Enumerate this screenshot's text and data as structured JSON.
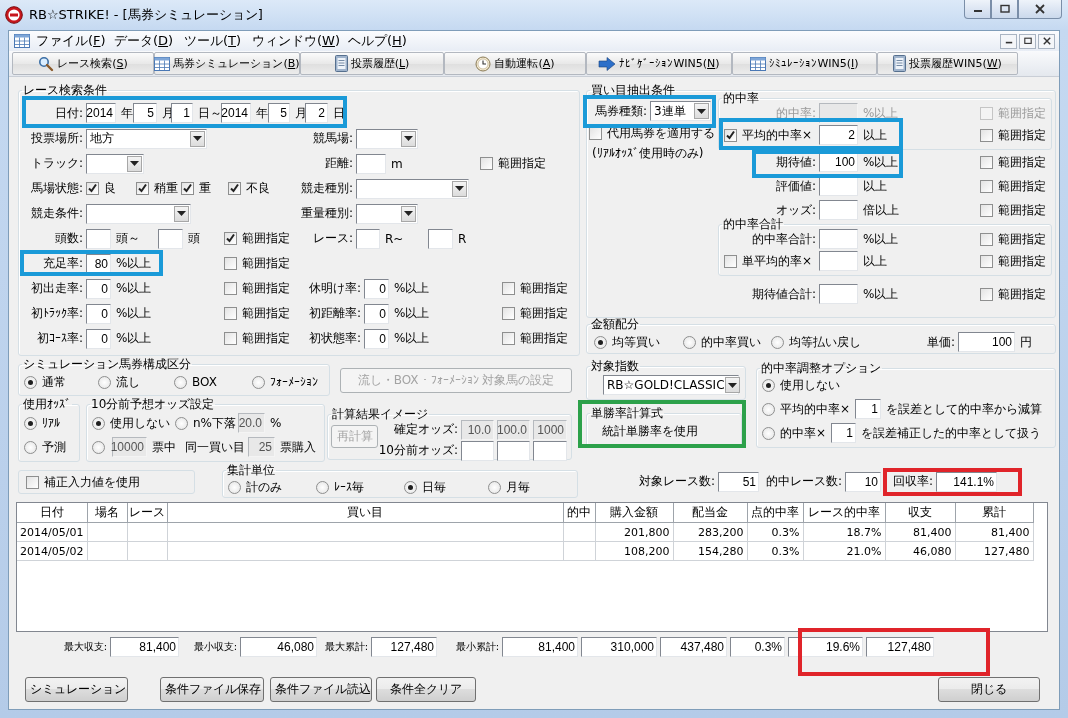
{
  "window": {
    "title": "RB☆STRIKE! - [馬券シミュレーション]"
  },
  "menu": [
    "ファイル(F)",
    "データ(D)",
    "ツール(T)",
    "ウィンドウ(W)",
    "ヘルプ(H)"
  ],
  "toolbar": [
    "レース検索(S)",
    "馬券シミュレーション(B)",
    "投票履歴(L)",
    "自動運転(A)",
    "ﾅﾋﾞｹﾞｰｼｮﾝWIN5(N)",
    "ｼﾐｭﾚｰｼｮﾝWIN5(I)",
    "投票履歴WIN5(W)"
  ],
  "search_conditions": {
    "title": "レース検索条件",
    "rows": [
      {
        "items": [
          {
            "kind": "label",
            "text": "日付:"
          },
          {
            "kind": "field",
            "value": "2014"
          },
          {
            "kind": "text",
            "text": "年"
          },
          {
            "kind": "field",
            "value": "5"
          },
          {
            "kind": "text",
            "text": "月"
          },
          {
            "kind": "field",
            "value": "1"
          },
          {
            "kind": "text",
            "text": "日～"
          },
          {
            "kind": "field",
            "value": "2014"
          },
          {
            "kind": "text",
            "text": "年"
          },
          {
            "kind": "field",
            "value": "5"
          },
          {
            "kind": "text",
            "text": "月"
          },
          {
            "kind": "field",
            "value": "2"
          },
          {
            "kind": "text",
            "text": "日"
          }
        ]
      },
      {
        "items": [
          {
            "kind": "label",
            "text": "投票場所:"
          },
          {
            "kind": "combo",
            "value": "地方"
          },
          {
            "kind": "label",
            "text": "競馬場:"
          },
          {
            "kind": "combo"
          }
        ]
      },
      {
        "items": [
          {
            "kind": "label",
            "text": "トラック:"
          },
          {
            "kind": "combo"
          },
          {
            "kind": "label",
            "text": "距離:"
          },
          {
            "kind": "field"
          },
          {
            "kind": "text",
            "text": "m"
          },
          {
            "kind": "check",
            "label": "範囲指定",
            "checked": false
          }
        ]
      },
      {
        "items": [
          {
            "kind": "label",
            "text": "馬場状態:"
          },
          {
            "kind": "check",
            "label": "良",
            "checked": true
          },
          {
            "kind": "check",
            "label": "稍重",
            "checked": true
          },
          {
            "kind": "check",
            "label": "重",
            "checked": true
          },
          {
            "kind": "check",
            "label": "不良",
            "checked": true
          },
          {
            "kind": "label",
            "text": "競走種別:"
          },
          {
            "kind": "combo"
          }
        ]
      },
      {
        "items": [
          {
            "kind": "label",
            "text": "競走条件:"
          },
          {
            "kind": "combo"
          },
          {
            "kind": "label",
            "text": "重量種別:"
          },
          {
            "kind": "combo"
          }
        ]
      },
      {
        "items": [
          {
            "kind": "label",
            "text": "頭数:"
          },
          {
            "kind": "field"
          },
          {
            "kind": "text",
            "text": "頭～"
          },
          {
            "kind": "field"
          },
          {
            "kind": "text",
            "text": "頭"
          },
          {
            "kind": "check",
            "label": "範囲指定",
            "checked": true
          },
          {
            "kind": "label",
            "text": "レース:"
          },
          {
            "kind": "field"
          },
          {
            "kind": "text",
            "text": "R~"
          },
          {
            "kind": "field"
          },
          {
            "kind": "text",
            "text": "R"
          }
        ]
      },
      {
        "items": [
          {
            "kind": "label",
            "text": "充足率:"
          },
          {
            "kind": "field",
            "value": "80"
          },
          {
            "kind": "text",
            "text": "%以上"
          },
          {
            "kind": "check",
            "label": "範囲指定",
            "checked": false
          }
        ]
      },
      {
        "items": [
          {
            "kind": "label",
            "text": "初出走率:"
          },
          {
            "kind": "field",
            "value": "0"
          },
          {
            "kind": "text",
            "text": "%以上"
          },
          {
            "kind": "check",
            "label": "範囲指定",
            "checked": false
          },
          {
            "kind": "label",
            "text": "休明け率:"
          },
          {
            "kind": "field",
            "value": "0"
          },
          {
            "kind": "text",
            "text": "%以上"
          },
          {
            "kind": "check",
            "label": "範囲指定",
            "checked": false
          }
        ]
      },
      {
        "items": [
          {
            "kind": "label",
            "text": "初ﾄﾗｯｸ率:"
          },
          {
            "kind": "field",
            "value": "0"
          },
          {
            "kind": "text",
            "text": "%以上"
          },
          {
            "kind": "check",
            "label": "範囲指定",
            "checked": false
          },
          {
            "kind": "label",
            "text": "初距離率:"
          },
          {
            "kind": "field",
            "value": "0"
          },
          {
            "kind": "text",
            "text": "%以上"
          },
          {
            "kind": "check",
            "label": "範囲指定",
            "checked": false
          }
        ]
      },
      {
        "items": [
          {
            "kind": "label",
            "text": "初ｺｰｽ率:"
          },
          {
            "kind": "field",
            "value": "0"
          },
          {
            "kind": "text",
            "text": "%以上"
          },
          {
            "kind": "check",
            "label": "範囲指定",
            "checked": false
          },
          {
            "kind": "label",
            "text": "初状態率:"
          },
          {
            "kind": "field",
            "value": "0"
          },
          {
            "kind": "text",
            "text": "%以上"
          },
          {
            "kind": "check",
            "label": "範囲指定",
            "checked": false
          }
        ]
      }
    ]
  },
  "simulation_type": {
    "title": "シミュレーション馬券構成区分",
    "options": [
      {
        "label": "通常",
        "selected": true
      },
      {
        "label": "流し",
        "selected": false
      },
      {
        "label": "BOX",
        "selected": false
      },
      {
        "label": "ﾌｫｰﾒｰｼｮﾝ",
        "selected": false
      }
    ]
  },
  "formation_button": {
    "label": "流し・BOX・ﾌｫｰﾒｰｼｮﾝ 対象馬の設定",
    "disabled": true
  },
  "odds_type": {
    "title": "使用ｵｯｽﾞ",
    "options": [
      {
        "label": "ﾘｱﾙ",
        "selected": true
      },
      {
        "label": "予測",
        "selected": false
      }
    ]
  },
  "pre_odds": {
    "title": "10分前予想オッズ設定",
    "rows": [
      {
        "items": [
          {
            "kind": "radio",
            "label": "使用しない",
            "selected": true,
            "disabled": false
          },
          {
            "kind": "radio",
            "label": "n%下落",
            "selected": false,
            "disabled": false
          },
          {
            "kind": "field",
            "value": "20.0",
            "disabled": true
          },
          {
            "kind": "text",
            "text": "%",
            "disabled": false
          }
        ]
      },
      {
        "items": [
          {
            "kind": "radio",
            "selected": false,
            "disabled": false
          },
          {
            "kind": "field",
            "value": "10000",
            "disabled": true
          },
          {
            "kind": "text",
            "text": "票中",
            "disabled": false
          },
          {
            "kind": "text",
            "text": "同一買い目",
            "disabled": false
          },
          {
            "kind": "field",
            "value": "25",
            "disabled": true
          },
          {
            "kind": "text",
            "text": "票購入",
            "disabled": false
          }
        ]
      }
    ]
  },
  "calc_image": {
    "title": "計算結果イメージ",
    "button": {
      "label": "再計算",
      "disabled": true
    },
    "rows": [
      {
        "items": [
          {
            "kind": "label",
            "text": "確定オッズ:",
            "disabled": false
          },
          {
            "kind": "field",
            "value": "10.0",
            "disabled": true
          },
          {
            "kind": "field",
            "value": "100.0",
            "disabled": true
          },
          {
            "kind": "field",
            "value": "1000",
            "disabled": true
          }
        ]
      },
      {
        "items": [
          {
            "kind": "label",
            "text": "10分前オッズ:",
            "disabled": false
          },
          {
            "kind": "field",
            "disabled": false
          },
          {
            "kind": "field",
            "disabled": false
          },
          {
            "kind": "field",
            "disabled": false
          }
        ]
      }
    ]
  },
  "bet_conditions": {
    "title": "買い目抽出条件",
    "side": [
      {
        "items": [
          {
            "kind": "label",
            "text": "馬券種類:"
          },
          {
            "kind": "combo",
            "value": "3連単"
          }
        ]
      },
      {
        "items": [
          {
            "kind": "check",
            "label": "代用馬券を適用する",
            "checked": false
          }
        ]
      },
      {
        "items": [
          {
            "kind": "text",
            "text": "(ﾘｱﾙｵｯｽﾞ使用時のみ)"
          }
        ]
      }
    ],
    "hit_rate": {
      "title": "的中率",
      "rows": [
        {
          "items": [
            {
              "kind": "label",
              "text": "的中率:",
              "disabled": true
            },
            {
              "kind": "field",
              "disabled": true
            },
            {
              "kind": "text",
              "text": "%以上",
              "disabled": true
            },
            {
              "kind": "check",
              "label": "範囲指定",
              "checked": false,
              "disabled": true
            }
          ]
        },
        {
          "items": [
            {
              "kind": "check",
              "label": "平均的中率×",
              "checked": true,
              "disabled": false
            },
            {
              "kind": "field",
              "value": "2",
              "disabled": false
            },
            {
              "kind": "text",
              "text": "以上",
              "disabled": false
            },
            {
              "kind": "check",
              "label": "範囲指定",
              "checked": false,
              "disabled": false
            }
          ]
        }
      ]
    },
    "rows": [
      {
        "items": [
          {
            "kind": "label",
            "text": "期待値:"
          },
          {
            "kind": "field",
            "value": "100"
          },
          {
            "kind": "text",
            "text": "%以上"
          },
          {
            "kind": "check",
            "label": "範囲指定",
            "checked": false
          }
        ]
      },
      {
        "items": [
          {
            "kind": "label",
            "text": "評価値:"
          },
          {
            "kind": "field"
          },
          {
            "kind": "text",
            "text": "以上"
          },
          {
            "kind": "check",
            "label": "範囲指定",
            "checked": false
          }
        ]
      },
      {
        "items": [
          {
            "kind": "label",
            "text": "オッズ:"
          },
          {
            "kind": "field"
          },
          {
            "kind": "text",
            "text": "倍以上"
          },
          {
            "kind": "check",
            "label": "範囲指定",
            "checked": false
          }
        ]
      }
    ],
    "hit_total": {
      "title": "的中率合計",
      "rows": [
        {
          "items": [
            {
              "kind": "label",
              "text": "的中率合計:"
            },
            {
              "kind": "field"
            },
            {
              "kind": "text",
              "text": "%以上"
            },
            {
              "kind": "check",
              "label": "範囲指定",
              "checked": false
            }
          ]
        },
        {
          "items": [
            {
              "kind": "check",
              "label": "単平均的率×",
              "checked": false
            },
            {
              "kind": "field"
            },
            {
              "kind": "text",
              "text": "以上"
            },
            {
              "kind": "check",
              "label": "範囲指定",
              "checked": false
            }
          ]
        }
      ]
    },
    "rows2": [
      {
        "items": [
          {
            "kind": "label",
            "text": "期待値合計:"
          },
          {
            "kind": "field"
          },
          {
            "kind": "text",
            "text": "%以上"
          },
          {
            "kind": "check",
            "label": "範囲指定",
            "checked": false
          }
        ]
      }
    ]
  },
  "allocation": {
    "title": "金額配分",
    "row": [
      {
        "kind": "radio",
        "label": "均等買い",
        "selected": true
      },
      {
        "kind": "radio",
        "label": "的中率買い",
        "selected": false
      },
      {
        "kind": "radio",
        "label": "均等払い戻し",
        "selected": false
      },
      {
        "kind": "label",
        "text": "単価:"
      },
      {
        "kind": "field",
        "value": "100"
      },
      {
        "kind": "text",
        "text": "円"
      }
    ]
  },
  "target_index": {
    "title": "対象指数",
    "row": [
      {
        "kind": "combo",
        "value": "RB☆GOLD!CLASSIC"
      }
    ]
  },
  "win_formula": {
    "title": "単勝率計算式",
    "text": "統計単勝率を使用"
  },
  "adjust_option": {
    "title": "的中率調整オプション",
    "rows": [
      {
        "items": [
          {
            "kind": "radio",
            "label": "使用しない",
            "selected": true
          }
        ]
      },
      {
        "items": [
          {
            "kind": "radio",
            "label": "平均的中率×",
            "selected": false
          },
          {
            "kind": "field",
            "value": "1"
          },
          {
            "kind": "text",
            "text": "を誤差として的中率から減算"
          }
        ]
      },
      {
        "items": [
          {
            "kind": "radio",
            "label": "的中率×",
            "selected": false
          },
          {
            "kind": "field",
            "value": "1"
          },
          {
            "kind": "text",
            "text": "を誤差補正した的中率として扱う"
          }
        ]
      }
    ]
  },
  "correction": {
    "label": "補正入力値を使用",
    "checked": false
  },
  "aggregation": {
    "title": "集計単位",
    "options": [
      {
        "label": "計のみ",
        "selected": false
      },
      {
        "label": "ﾚｰｽ毎",
        "selected": false
      },
      {
        "label": "日毎",
        "selected": true
      },
      {
        "label": "月毎",
        "selected": false
      }
    ]
  },
  "summary": [
    {
      "kind": "label",
      "text": "対象レース数:"
    },
    {
      "kind": "field",
      "value": "51"
    },
    {
      "kind": "label",
      "text": "的中レース数:"
    },
    {
      "kind": "field",
      "value": "10"
    },
    {
      "kind": "label",
      "text": "回収率:"
    },
    {
      "kind": "field",
      "value": "141.1%"
    }
  ],
  "table": {
    "columns": [
      "日付",
      "場名",
      "レース",
      "買い目",
      "的中",
      "購入金額",
      "配当金",
      "点的中率",
      "レース的中率",
      "収支",
      "累計"
    ],
    "rows": [
      {
        "cells": [
          "2014/05/01",
          null,
          null,
          null,
          null,
          "201,800",
          "283,200",
          "0.3%",
          "18.7%",
          "81,400",
          "81,400"
        ]
      },
      {
        "cells": [
          "2014/05/02",
          null,
          null,
          null,
          null,
          "108,200",
          "154,280",
          "0.3%",
          "21.0%",
          "46,080",
          "127,480"
        ]
      }
    ]
  },
  "totals": [
    {
      "kind": "label",
      "text": "最大収支:"
    },
    {
      "kind": "field",
      "value": "81,400"
    },
    {
      "kind": "label",
      "text": "最小収支:"
    },
    {
      "kind": "field",
      "value": "46,080"
    },
    {
      "kind": "label",
      "text": "最大累計:"
    },
    {
      "kind": "field",
      "value": "127,480"
    },
    {
      "kind": "label",
      "text": "最小累計:"
    },
    {
      "kind": "field",
      "value": "81,400"
    },
    {
      "kind": "field",
      "value": "310,000"
    },
    {
      "kind": "field",
      "value": "437,480"
    },
    {
      "kind": "field",
      "value": "0.3%"
    },
    {
      "kind": "field",
      "value": "19.6%"
    },
    {
      "kind": "field",
      "value": "127,480"
    }
  ],
  "buttons": [
    "シミュレーション",
    "条件ファイル保存",
    "条件ファイル読込",
    "条件全クリア",
    "閉じる"
  ],
  "highlights": [
    {
      "color": "#1a9ad8"
    },
    {
      "color": "#1a9ad8"
    },
    {
      "color": "#1a9ad8"
    },
    {
      "color": "#1a9ad8"
    },
    {
      "color": "#1a9ad8"
    },
    {
      "color": "#2ca14a"
    },
    {
      "color": "#e0242a"
    },
    {
      "color": "#e0242a"
    }
  ]
}
